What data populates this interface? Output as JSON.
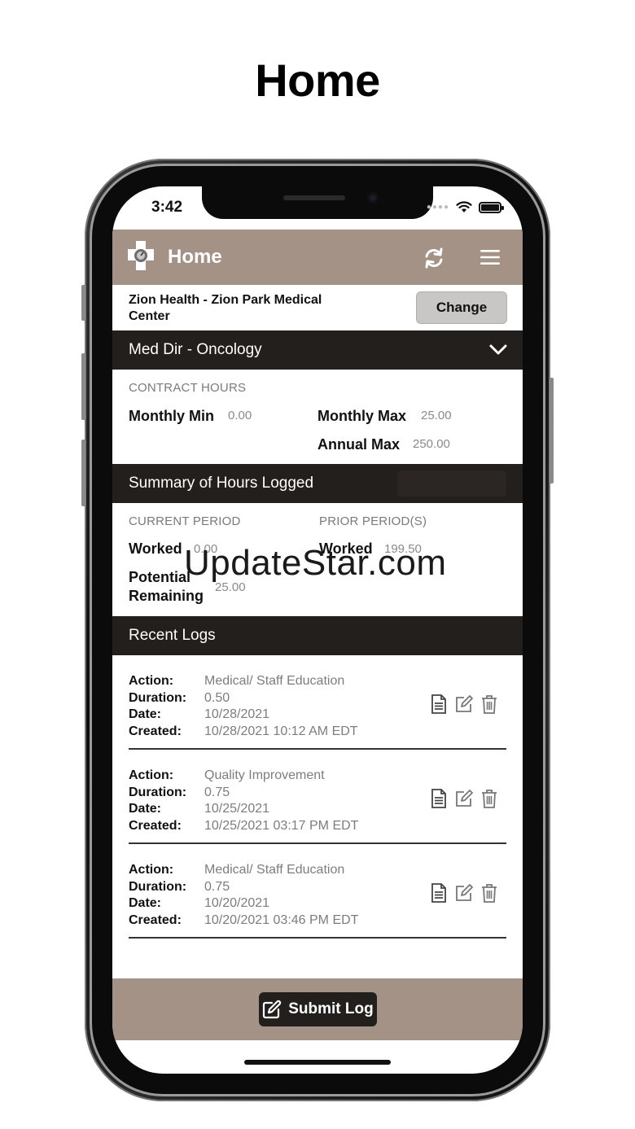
{
  "heading": "Home",
  "status": {
    "time": "3:42"
  },
  "header": {
    "title": "Home"
  },
  "facility": {
    "name": "Zion Health - Zion Park Medical Center",
    "change_label": "Change"
  },
  "department": {
    "name": "Med Dir - Oncology"
  },
  "contract": {
    "section_label": "CONTRACT HOURS",
    "monthly_min_label": "Monthly Min",
    "monthly_min": "0.00",
    "monthly_max_label": "Monthly Max",
    "monthly_max": "25.00",
    "annual_max_label": "Annual Max",
    "annual_max": "250.00"
  },
  "summary": {
    "title": "Summary of Hours Logged",
    "current_label": "CURRENT PERIOD",
    "prior_label": "PRIOR PERIOD(S)",
    "worked_label": "Worked",
    "current_worked": "0.00",
    "prior_worked": "199.50",
    "potential_label_1": "Potential",
    "potential_label_2": "Remaining",
    "potential_remaining": "25.00"
  },
  "watermark": "UpdateStar.com",
  "recent": {
    "title": "Recent Logs",
    "field_labels": {
      "action": "Action:",
      "duration": "Duration:",
      "date": "Date:",
      "created": "Created:"
    },
    "logs": [
      {
        "action": "Medical/ Staff Education",
        "duration": "0.50",
        "date": "10/28/2021",
        "created": "10/28/2021 10:12 AM EDT"
      },
      {
        "action": "Quality Improvement",
        "duration": "0.75",
        "date": "10/25/2021",
        "created": "10/25/2021 03:17 PM EDT"
      },
      {
        "action": "Medical/ Staff Education",
        "duration": "0.75",
        "date": "10/20/2021",
        "created": "10/20/2021 03:46 PM EDT"
      }
    ]
  },
  "footer": {
    "submit_label": "Submit Log"
  },
  "colors": {
    "header_bg": "#a39285",
    "section_bg": "#231f1c",
    "change_bg": "#c9c6c6"
  }
}
